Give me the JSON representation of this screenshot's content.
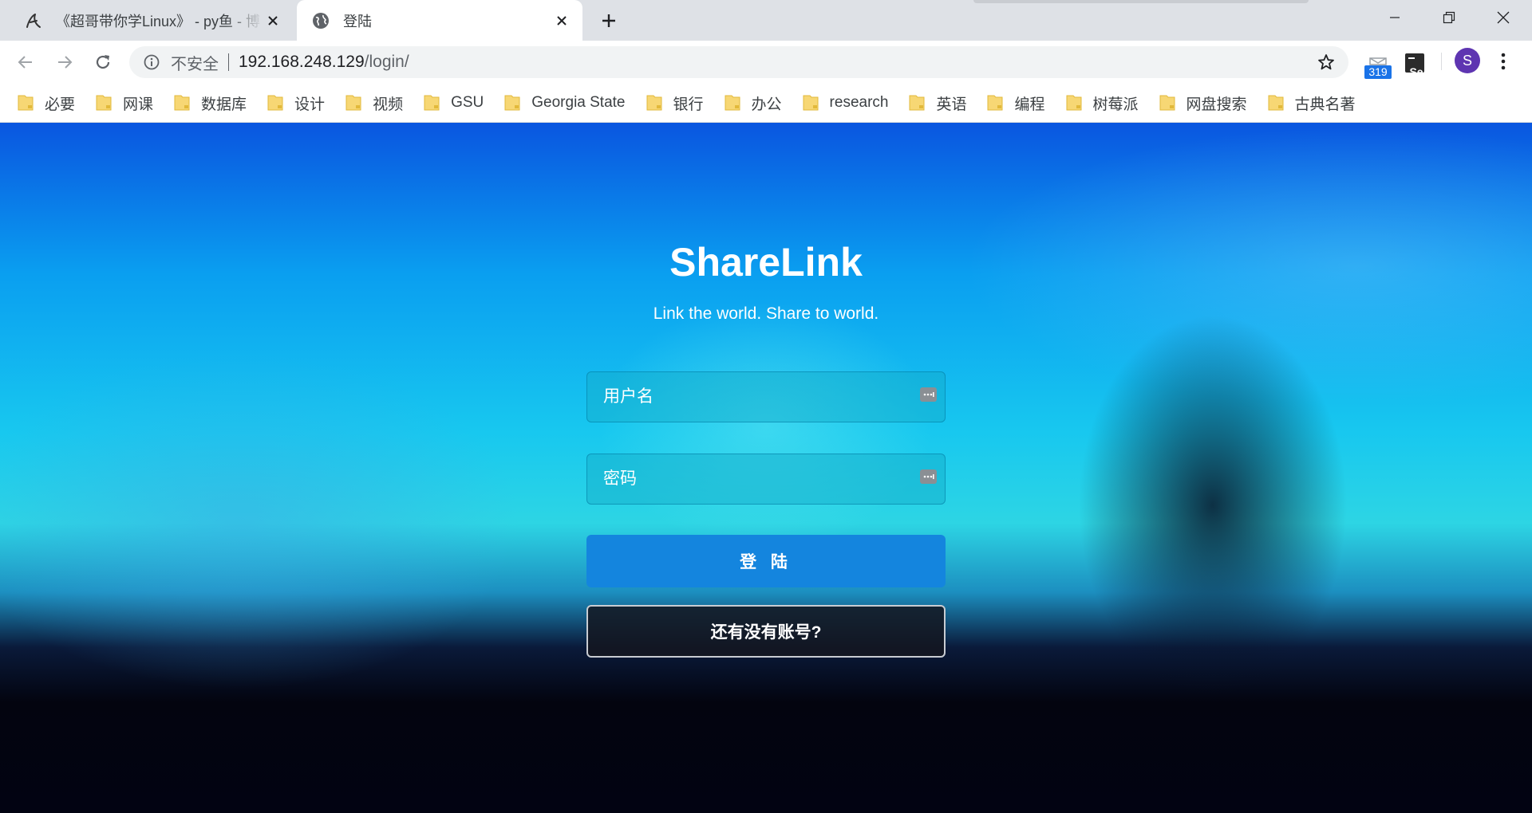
{
  "browser": {
    "tabs": [
      {
        "title": "《超哥带你学Linux》 - py鱼 - 博",
        "active": false,
        "favicon": "python-fish-icon"
      },
      {
        "title": "登陆",
        "active": true,
        "favicon": "globe-icon"
      }
    ],
    "address": {
      "security_label": "不安全",
      "host": "192.168.248.129",
      "path": "/login/"
    },
    "extension_badge": "319",
    "profile_initial": "S",
    "ext_se_label": "Se",
    "colors": {
      "chrome_bg": "#dee1e6",
      "avatar": "#5e35b1",
      "badge": "#1a73e8"
    }
  },
  "bookmarks": [
    "必要",
    "网课",
    "数据库",
    "设计",
    "视频",
    "GSU",
    "Georgia State",
    "银行",
    "办公",
    "research",
    "英语",
    "编程",
    "树莓派",
    "网盘搜索",
    "古典名著"
  ],
  "login": {
    "brand": "ShareLink",
    "slogan": "Link the world. Share to world.",
    "username_placeholder": "用户名",
    "password_placeholder": "密码",
    "login_button": "登 陆",
    "register_button": "还有没有账号?",
    "colors": {
      "primary": "#1485de"
    }
  }
}
